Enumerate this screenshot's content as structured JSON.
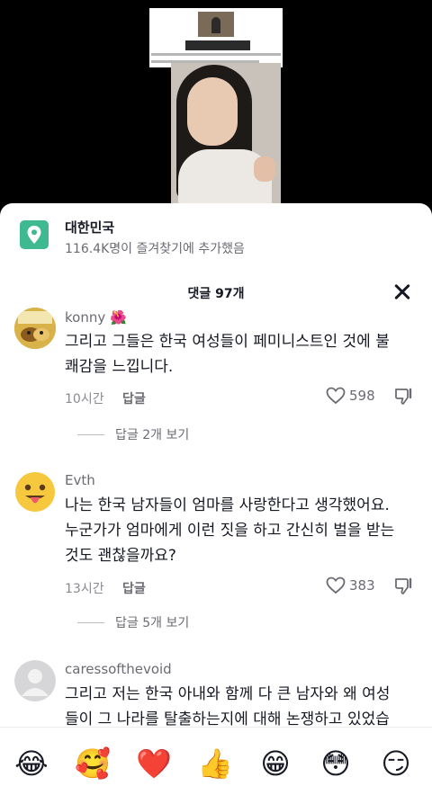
{
  "place": {
    "name": "대한민국",
    "subtitle": "116.4K명이 즐겨찾기에 추가했음"
  },
  "comments_header": {
    "title": "댓글 97개"
  },
  "comments": [
    {
      "username": "konny",
      "username_emoji": "🌺",
      "text_lines": [
        "그리고 그들은 한국 여성들이 페미니스트인 것에 불",
        "쾌감을 느낍니다."
      ],
      "time": "10시간",
      "reply_label": "답글",
      "likes": "598",
      "view_replies": "답글 2개 보기"
    },
    {
      "username": "Evth",
      "text_lines": [
        "나는 한국 남자들이 엄마를 사랑한다고 생각했어요.",
        "누군가가 엄마에게 이런 짓을 하고 간신히 벌을 받는",
        "것도 괜찮을까요?"
      ],
      "time": "13시간",
      "reply_label": "답글",
      "likes": "383",
      "view_replies": "답글 5개 보기"
    },
    {
      "username": "caressofthevoid",
      "text_lines": [
        "그리고 저는 한국 아내와 함께 다 큰 남자와 왜 여성",
        "들이 그 나라를 탈출하는지에 대해 논쟁하고 있었습"
      ]
    }
  ],
  "emoji_bar": [
    "😂",
    "🥰",
    "❤️",
    "👍",
    "😁",
    "😳",
    "😏"
  ],
  "colors": {
    "place_icon": "#3fb98f",
    "text_primary": "#161823",
    "text_secondary": "#6b6b73"
  }
}
